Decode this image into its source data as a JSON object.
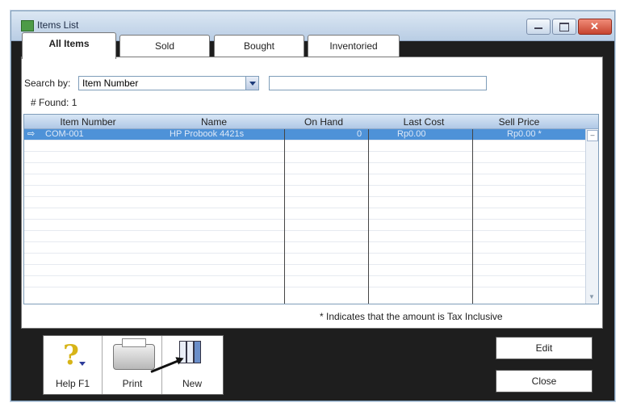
{
  "window": {
    "title": "Items List"
  },
  "tabs": [
    {
      "label": "All Items",
      "active": true
    },
    {
      "label": "Sold",
      "active": false
    },
    {
      "label": "Bought",
      "active": false
    },
    {
      "label": "Inventoried",
      "active": false
    }
  ],
  "search": {
    "label": "Search by:",
    "field": "Item Number",
    "value": ""
  },
  "found": {
    "label": "# Found:",
    "count": "1"
  },
  "table": {
    "columns": [
      "Item Number",
      "Name",
      "On Hand",
      "Last Cost",
      "Sell Price"
    ],
    "rows": [
      {
        "item_number": "COM-001",
        "name": "HP Probook 4421s",
        "on_hand": "0",
        "last_cost": "Rp0.00",
        "sell_price": "Rp0.00 *"
      }
    ]
  },
  "note": "* Indicates that the amount is Tax Inclusive",
  "toolbar": {
    "help": "Help F1",
    "print": "Print",
    "new": "New"
  },
  "buttons": {
    "edit": "Edit",
    "close": "Close"
  }
}
